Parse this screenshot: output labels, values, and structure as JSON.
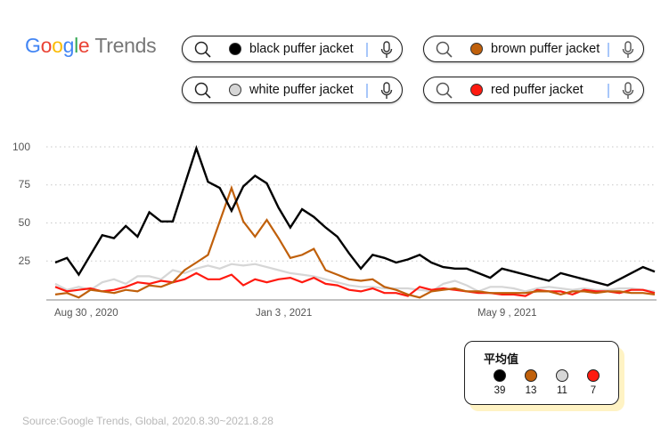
{
  "header": {
    "logo": {
      "parts": [
        "G",
        "o",
        "o",
        "g",
        "l",
        "e"
      ],
      "suffix": "Trends"
    }
  },
  "searches": [
    {
      "term": "black puffer jacket",
      "color": "#000000"
    },
    {
      "term": "brown puffer jacket",
      "color": "#c0600b"
    },
    {
      "term": "white puffer jacket",
      "color": "#d6d6d6"
    },
    {
      "term": "red puffer jacket",
      "color": "#ff1a10"
    }
  ],
  "legend": {
    "title": "平均值",
    "items": [
      {
        "name": "black puffer jacket",
        "color": "#000000",
        "value": "39"
      },
      {
        "name": "brown puffer jacket",
        "color": "#c0600b",
        "value": "13"
      },
      {
        "name": "white puffer jacket",
        "color": "#d6d6d6",
        "value": "11"
      },
      {
        "name": "red puffer jacket",
        "color": "#ff1a10",
        "value": "7"
      }
    ]
  },
  "source": "Source:Google Trends, Global, 2020.8.30~2021.8.28",
  "chart_data": {
    "type": "line",
    "title": "",
    "xlabel": "",
    "ylabel": "",
    "ylim": [
      0,
      100
    ],
    "yticks": [
      "100",
      "75",
      "50",
      "25"
    ],
    "xtick_labels": [
      "Aug 30 , 2020",
      "Jan 3 , 2021",
      "May 9 , 2021"
    ],
    "xtick_index": [
      0,
      18,
      36
    ],
    "grid": true,
    "x_count": 52,
    "series": [
      {
        "name": "black puffer jacket",
        "color": "#000000",
        "values": [
          24,
          27,
          16,
          29,
          42,
          40,
          48,
          41,
          57,
          51,
          51,
          75,
          99,
          77,
          73,
          58,
          74,
          81,
          76,
          60,
          47,
          59,
          54,
          47,
          41,
          30,
          20,
          29,
          27,
          24,
          26,
          29,
          24,
          21,
          20,
          20,
          17,
          14,
          20,
          18,
          16,
          14,
          12,
          17,
          15,
          13,
          11,
          9,
          13,
          17,
          21,
          18
        ]
      },
      {
        "name": "brown puffer jacket",
        "color": "#c0600b",
        "values": [
          3,
          4,
          1,
          6,
          5,
          4,
          6,
          5,
          9,
          8,
          11,
          19,
          24,
          29,
          51,
          73,
          51,
          41,
          52,
          40,
          27,
          29,
          33,
          19,
          16,
          13,
          12,
          13,
          8,
          6,
          3,
          1,
          5,
          6,
          7,
          5,
          5,
          4,
          4,
          4,
          4,
          5,
          5,
          3,
          5,
          5,
          4,
          5,
          5,
          4,
          4,
          3
        ]
      },
      {
        "name": "white puffer jacket",
        "color": "#d6d6d6",
        "values": [
          10,
          6,
          8,
          6,
          11,
          13,
          10,
          15,
          15,
          13,
          19,
          17,
          20,
          22,
          20,
          23,
          22,
          23,
          21,
          19,
          17,
          16,
          15,
          13,
          11,
          9,
          8,
          8,
          7,
          7,
          7,
          6,
          5,
          10,
          12,
          9,
          5,
          8,
          8,
          7,
          5,
          7,
          8,
          7,
          6,
          7,
          6,
          6,
          7,
          7,
          6,
          5
        ]
      },
      {
        "name": "red puffer jacket",
        "color": "#ff1a10",
        "values": [
          8,
          5,
          6,
          7,
          5,
          6,
          8,
          11,
          10,
          12,
          11,
          13,
          17,
          13,
          13,
          16,
          9,
          13,
          11,
          13,
          14,
          11,
          14,
          10,
          9,
          6,
          5,
          7,
          4,
          4,
          2,
          8,
          6,
          7,
          6,
          5,
          4,
          4,
          3,
          3,
          2,
          6,
          5,
          5,
          3,
          6,
          5,
          5,
          4,
          6,
          6,
          4
        ]
      }
    ]
  }
}
